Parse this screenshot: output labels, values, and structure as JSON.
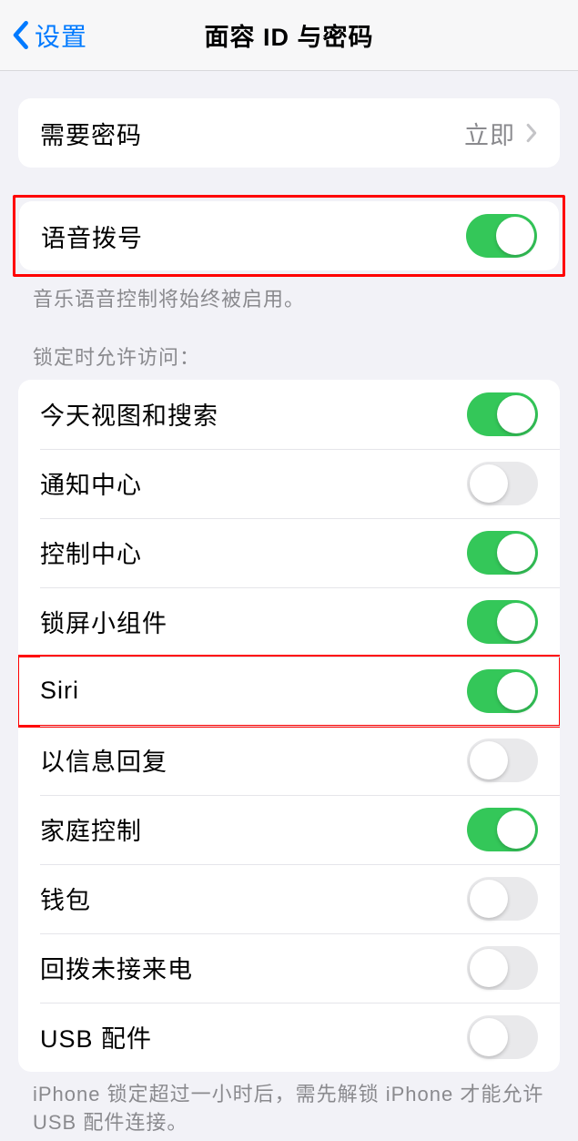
{
  "nav": {
    "back_label": "设置",
    "title": "面容 ID 与密码"
  },
  "passcode_group": {
    "require_passcode": {
      "label": "需要密码",
      "value": "立即"
    }
  },
  "voice_dial": {
    "label": "语音拨号",
    "on": true,
    "footer": "音乐语音控制将始终被启用。"
  },
  "lock_access": {
    "header": "锁定时允许访问：",
    "items": [
      {
        "label": "今天视图和搜索",
        "on": true,
        "highlighted": false
      },
      {
        "label": "通知中心",
        "on": false,
        "highlighted": false
      },
      {
        "label": "控制中心",
        "on": true,
        "highlighted": false
      },
      {
        "label": "锁屏小组件",
        "on": true,
        "highlighted": false
      },
      {
        "label": "Siri",
        "on": true,
        "highlighted": true
      },
      {
        "label": "以信息回复",
        "on": false,
        "highlighted": false
      },
      {
        "label": "家庭控制",
        "on": true,
        "highlighted": false
      },
      {
        "label": "钱包",
        "on": false,
        "highlighted": false
      },
      {
        "label": "回拨未接来电",
        "on": false,
        "highlighted": false
      },
      {
        "label": "USB 配件",
        "on": false,
        "highlighted": false
      }
    ],
    "footer": "iPhone 锁定超过一小时后，需先解锁 iPhone 才能允许USB 配件连接。"
  }
}
